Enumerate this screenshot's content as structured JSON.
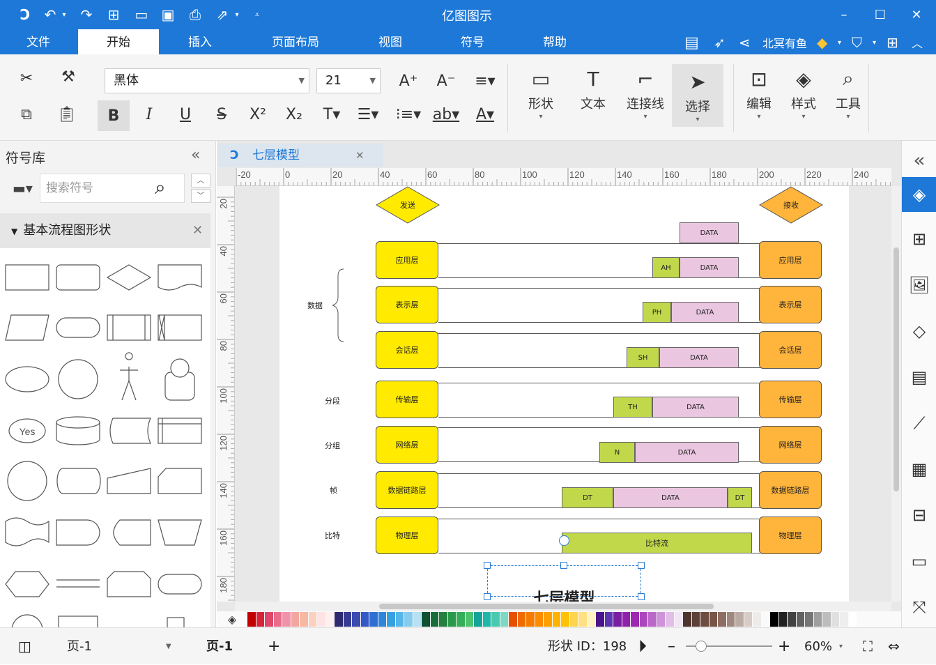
{
  "app": {
    "title": "亿图图示"
  },
  "menu": {
    "tabs": [
      "文件",
      "开始",
      "插入",
      "页面布局",
      "视图",
      "符号",
      "帮助"
    ],
    "active": "开始",
    "user": "北冥有鱼"
  },
  "ribbon": {
    "font": "黑体",
    "size": "21",
    "shape": "形状",
    "text": "文本",
    "connector": "连接线",
    "select": "选择",
    "edit": "编辑",
    "style": "样式",
    "tools": "工具"
  },
  "left": {
    "title": "符号库",
    "search_placeholder": "搜索符号",
    "library": "基本流程图形状",
    "yes": "Yes"
  },
  "doc": {
    "tab": "七层模型"
  },
  "ruler": {
    "h": [
      "-20",
      "0",
      "20",
      "40",
      "60",
      "80",
      "100",
      "120",
      "140",
      "160",
      "180",
      "200",
      "220",
      "240"
    ],
    "v": [
      "20",
      "40",
      "60",
      "80",
      "100",
      "120",
      "140",
      "160",
      "180"
    ]
  },
  "diagram": {
    "send": "发送",
    "recv": "接收",
    "layers": [
      "应用层",
      "表示层",
      "会话层",
      "传输层",
      "网络层",
      "数据链路层",
      "物理层"
    ],
    "data": "DATA",
    "ah": "AH",
    "ph": "PH",
    "sh": "SH",
    "th": "TH",
    "n": "N",
    "dt": "DT",
    "bits": "比特流",
    "side": [
      "数据",
      "分段",
      "分组",
      "帧",
      "比特"
    ],
    "title": "七层模型"
  },
  "status": {
    "page_sel": "页-1",
    "page_tab": "页-1",
    "add": "+",
    "shape_id": "形状 ID：198",
    "zoom": "60%"
  },
  "colors": {
    "accent": "#1e78d7",
    "yellow": "#ffea00",
    "orange": "#ffb43b",
    "green": "#c1d84a",
    "pink": "#ebc6e0"
  }
}
